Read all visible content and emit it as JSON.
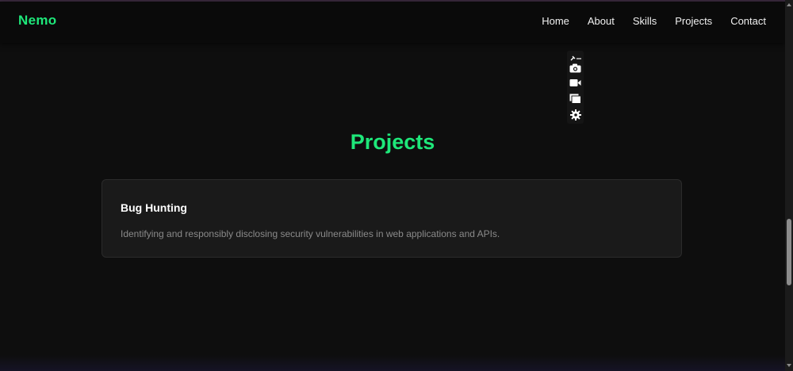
{
  "brand": {
    "name": "Nemo",
    "color": "#1ee87a"
  },
  "nav": {
    "items": [
      {
        "label": "Home"
      },
      {
        "label": "About"
      },
      {
        "label": "Skills"
      },
      {
        "label": "Projects"
      },
      {
        "label": "Contact"
      }
    ]
  },
  "toolbar": {
    "icons": [
      "link-more-icon",
      "camera-icon",
      "video-camera-icon",
      "window-icon",
      "gear-icon"
    ]
  },
  "projects": {
    "title": "Projects",
    "cards": [
      {
        "title": "Bug Hunting",
        "description": "Identifying and responsibly disclosing security vulnerabilities in web applications and APIs."
      }
    ]
  },
  "colors": {
    "background": "#0e0e0e",
    "accent": "#1ee87a",
    "card": "#1a1a1a",
    "muted_text": "#8a8a8a"
  }
}
